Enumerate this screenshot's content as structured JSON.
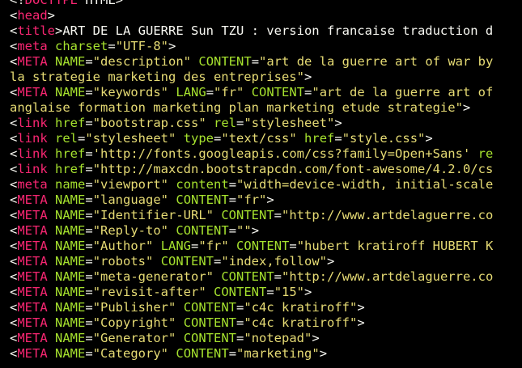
{
  "editor": {
    "theme_colors": {
      "background": "#000000",
      "tag": "#f92672",
      "attribute": "#a6e22e",
      "string": "#e6db74",
      "text": "#f8f8f2"
    },
    "lines": [
      [
        [
          "p",
          "<!"
        ],
        [
          "t",
          "DOCTYPE"
        ],
        [
          "p",
          " HTML>"
        ]
      ],
      [
        [
          "p",
          "<"
        ],
        [
          "t",
          "head"
        ],
        [
          "p",
          ">"
        ]
      ],
      [
        [
          "p",
          "<"
        ],
        [
          "t",
          "title"
        ],
        [
          "p",
          ">ART DE LA GUERRE Sun TZU : version francaise traduction d"
        ]
      ],
      [
        [
          "p",
          "<"
        ],
        [
          "t",
          "meta"
        ],
        [
          "p",
          " "
        ],
        [
          "a",
          "charset"
        ],
        [
          "p",
          "="
        ],
        [
          "s",
          "\"UTF-8\""
        ],
        [
          "p",
          ">"
        ]
      ],
      [
        [
          "p",
          "<"
        ],
        [
          "t",
          "META"
        ],
        [
          "p",
          " "
        ],
        [
          "a",
          "NAME"
        ],
        [
          "p",
          "="
        ],
        [
          "s",
          "\"description\""
        ],
        [
          "p",
          " "
        ],
        [
          "a",
          "CONTENT"
        ],
        [
          "p",
          "="
        ],
        [
          "s",
          "\"art de la guerre art of war by"
        ]
      ],
      [
        [
          "s",
          "la strategie marketing des entreprises\""
        ],
        [
          "p",
          ">"
        ]
      ],
      [
        [
          "p",
          "<"
        ],
        [
          "t",
          "META"
        ],
        [
          "p",
          " "
        ],
        [
          "a",
          "NAME"
        ],
        [
          "p",
          "="
        ],
        [
          "s",
          "\"keywords\""
        ],
        [
          "p",
          " "
        ],
        [
          "a",
          "LANG"
        ],
        [
          "p",
          "="
        ],
        [
          "s",
          "\"fr\""
        ],
        [
          "p",
          " "
        ],
        [
          "a",
          "CONTENT"
        ],
        [
          "p",
          "="
        ],
        [
          "s",
          "\"art de la guerre art of"
        ]
      ],
      [
        [
          "s",
          "anglaise formation marketing plan marketing etude strategie\""
        ],
        [
          "p",
          ">"
        ]
      ],
      [
        [
          "p",
          "<"
        ],
        [
          "t",
          "link"
        ],
        [
          "p",
          " "
        ],
        [
          "a",
          "href"
        ],
        [
          "p",
          "="
        ],
        [
          "s",
          "\"bootstrap.css\""
        ],
        [
          "p",
          " "
        ],
        [
          "a",
          "rel"
        ],
        [
          "p",
          "="
        ],
        [
          "s",
          "\"stylesheet\""
        ],
        [
          "p",
          ">"
        ]
      ],
      [
        [
          "p",
          "<"
        ],
        [
          "t",
          "link"
        ],
        [
          "p",
          " "
        ],
        [
          "a",
          "rel"
        ],
        [
          "p",
          "="
        ],
        [
          "s",
          "\"stylesheet\""
        ],
        [
          "p",
          " "
        ],
        [
          "a",
          "type"
        ],
        [
          "p",
          "="
        ],
        [
          "s",
          "\"text/css\""
        ],
        [
          "p",
          " "
        ],
        [
          "a",
          "href"
        ],
        [
          "p",
          "="
        ],
        [
          "s",
          "\"style.css\""
        ],
        [
          "p",
          ">"
        ]
      ],
      [
        [
          "p",
          "<"
        ],
        [
          "t",
          "link"
        ],
        [
          "p",
          " "
        ],
        [
          "a",
          "href"
        ],
        [
          "p",
          "="
        ],
        [
          "s",
          "'http://fonts.googleapis.com/css?family=Open+Sans'"
        ],
        [
          "p",
          " "
        ],
        [
          "a",
          "re"
        ]
      ],
      [
        [
          "p",
          "<"
        ],
        [
          "t",
          "link"
        ],
        [
          "p",
          " "
        ],
        [
          "a",
          "href"
        ],
        [
          "p",
          "="
        ],
        [
          "s",
          "\"http://maxcdn.bootstrapcdn.com/font-awesome/4.2.0/cs"
        ]
      ],
      [
        [
          "p",
          "<"
        ],
        [
          "t",
          "meta"
        ],
        [
          "p",
          " "
        ],
        [
          "a",
          "name"
        ],
        [
          "p",
          "="
        ],
        [
          "s",
          "\"viewport\""
        ],
        [
          "p",
          " "
        ],
        [
          "a",
          "content"
        ],
        [
          "p",
          "="
        ],
        [
          "s",
          "\"width=device-width, initial-scale"
        ]
      ],
      [
        [
          "p",
          "<"
        ],
        [
          "t",
          "META"
        ],
        [
          "p",
          " "
        ],
        [
          "a",
          "NAME"
        ],
        [
          "p",
          "="
        ],
        [
          "s",
          "\"language\""
        ],
        [
          "p",
          " "
        ],
        [
          "a",
          "CONTENT"
        ],
        [
          "p",
          "="
        ],
        [
          "s",
          "\"fr\""
        ],
        [
          "p",
          ">"
        ]
      ],
      [
        [
          "p",
          "<"
        ],
        [
          "t",
          "META"
        ],
        [
          "p",
          " "
        ],
        [
          "a",
          "NAME"
        ],
        [
          "p",
          "="
        ],
        [
          "s",
          "\"Identifier-URL\""
        ],
        [
          "p",
          " "
        ],
        [
          "a",
          "CONTENT"
        ],
        [
          "p",
          "="
        ],
        [
          "s",
          "\"http://www.artdelaguerre.co"
        ]
      ],
      [
        [
          "p",
          "<"
        ],
        [
          "t",
          "META"
        ],
        [
          "p",
          " "
        ],
        [
          "a",
          "NAME"
        ],
        [
          "p",
          "="
        ],
        [
          "s",
          "\"Reply-to\""
        ],
        [
          "p",
          " "
        ],
        [
          "a",
          "CONTENT"
        ],
        [
          "p",
          "="
        ],
        [
          "s",
          "\"\""
        ],
        [
          "p",
          ">"
        ]
      ],
      [
        [
          "p",
          "<"
        ],
        [
          "t",
          "META"
        ],
        [
          "p",
          " "
        ],
        [
          "a",
          "NAME"
        ],
        [
          "p",
          "="
        ],
        [
          "s",
          "\"Author\""
        ],
        [
          "p",
          " "
        ],
        [
          "a",
          "LANG"
        ],
        [
          "p",
          "="
        ],
        [
          "s",
          "\"fr\""
        ],
        [
          "p",
          " "
        ],
        [
          "a",
          "CONTENT"
        ],
        [
          "p",
          "="
        ],
        [
          "s",
          "\"hubert kratiroff HUBERT K"
        ]
      ],
      [
        [
          "p",
          "<"
        ],
        [
          "t",
          "META"
        ],
        [
          "p",
          " "
        ],
        [
          "a",
          "NAME"
        ],
        [
          "p",
          "="
        ],
        [
          "s",
          "\"robots\""
        ],
        [
          "p",
          " "
        ],
        [
          "a",
          "CONTENT"
        ],
        [
          "p",
          "="
        ],
        [
          "s",
          "\"index,follow\""
        ],
        [
          "p",
          ">"
        ]
      ],
      [
        [
          "p",
          "<"
        ],
        [
          "t",
          "META"
        ],
        [
          "p",
          " "
        ],
        [
          "a",
          "NAME"
        ],
        [
          "p",
          "="
        ],
        [
          "s",
          "\"meta-generator\""
        ],
        [
          "p",
          " "
        ],
        [
          "a",
          "CONTENT"
        ],
        [
          "p",
          "="
        ],
        [
          "s",
          "\"http://www.artdelaguerre.co"
        ]
      ],
      [
        [
          "p",
          "<"
        ],
        [
          "t",
          "META"
        ],
        [
          "p",
          " "
        ],
        [
          "a",
          "NAME"
        ],
        [
          "p",
          "="
        ],
        [
          "s",
          "\"revisit-after\""
        ],
        [
          "p",
          " "
        ],
        [
          "a",
          "CONTENT"
        ],
        [
          "p",
          "="
        ],
        [
          "s",
          "\"15\""
        ],
        [
          "p",
          ">"
        ]
      ],
      [
        [
          "p",
          "<"
        ],
        [
          "t",
          "META"
        ],
        [
          "p",
          " "
        ],
        [
          "a",
          "NAME"
        ],
        [
          "p",
          "="
        ],
        [
          "s",
          "\"Publisher\""
        ],
        [
          "p",
          " "
        ],
        [
          "a",
          "CONTENT"
        ],
        [
          "p",
          "="
        ],
        [
          "s",
          "\"c4c kratiroff\""
        ],
        [
          "p",
          ">"
        ]
      ],
      [
        [
          "p",
          "<"
        ],
        [
          "t",
          "META"
        ],
        [
          "p",
          " "
        ],
        [
          "a",
          "NAME"
        ],
        [
          "p",
          "="
        ],
        [
          "s",
          "\"Copyright\""
        ],
        [
          "p",
          " "
        ],
        [
          "a",
          "CONTENT"
        ],
        [
          "p",
          "="
        ],
        [
          "s",
          "\"c4c kratiroff\""
        ],
        [
          "p",
          ">"
        ]
      ],
      [
        [
          "p",
          "<"
        ],
        [
          "t",
          "META"
        ],
        [
          "p",
          " "
        ],
        [
          "a",
          "NAME"
        ],
        [
          "p",
          "="
        ],
        [
          "s",
          "\"Generator\""
        ],
        [
          "p",
          " "
        ],
        [
          "a",
          "CONTENT"
        ],
        [
          "p",
          "="
        ],
        [
          "s",
          "\"notepad\""
        ],
        [
          "p",
          ">"
        ]
      ],
      [
        [
          "p",
          "<"
        ],
        [
          "t",
          "META"
        ],
        [
          "p",
          " "
        ],
        [
          "a",
          "NAME"
        ],
        [
          "p",
          "="
        ],
        [
          "s",
          "\"Category\""
        ],
        [
          "p",
          " "
        ],
        [
          "a",
          "CONTENT"
        ],
        [
          "p",
          "="
        ],
        [
          "s",
          "\"marketing\""
        ],
        [
          "p",
          ">"
        ]
      ]
    ]
  }
}
